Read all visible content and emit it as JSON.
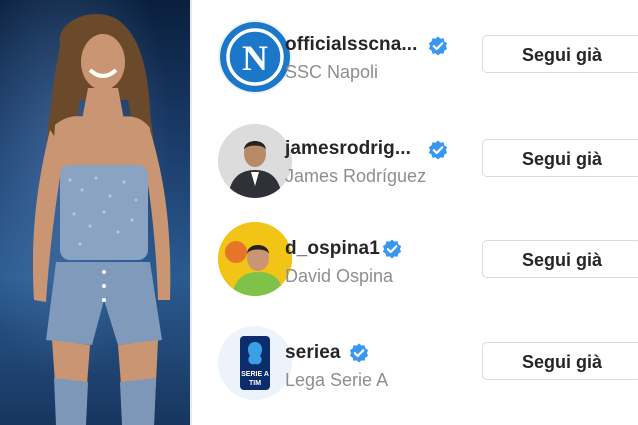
{
  "accounts": [
    {
      "username": "officialsscna...",
      "full_name": "SSC Napoli",
      "verified": true,
      "button_label": "Segui già",
      "avatar": "ssc-napoli-logo"
    },
    {
      "username": "jamesrodrig...",
      "full_name": "James Rodríguez",
      "verified": true,
      "button_label": "Segui già",
      "avatar": "james-rodriguez-photo"
    },
    {
      "username": "d_ospina1",
      "full_name": "David Ospina",
      "verified": true,
      "button_label": "Segui già",
      "avatar": "david-ospina-photo"
    },
    {
      "username": "seriea",
      "full_name": "Lega Serie A",
      "verified": true,
      "button_label": "Segui già",
      "avatar": "serie-a-logo"
    }
  ],
  "colors": {
    "verified_badge": "#3897f0",
    "napoli_blue": "#1b78c8",
    "username_text": "#262626",
    "subtitle_text": "#8e8e8e",
    "button_border": "#dbdbdb"
  },
  "logo_text": {
    "napoli_logo_letter": "N",
    "seriea_logo_line1": "SERIE A",
    "seriea_logo_line2": "TIM"
  }
}
